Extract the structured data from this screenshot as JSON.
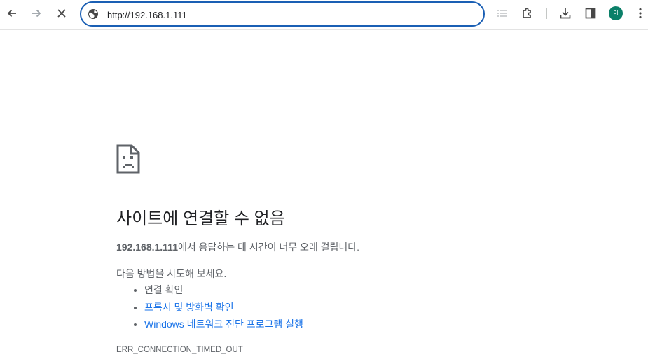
{
  "toolbar": {
    "back_icon": "arrow-left-icon",
    "forward_icon": "arrow-right-icon",
    "stop_icon": "close-icon",
    "omnibox": {
      "site_icon": "globe-icon",
      "url": "http://192.168.1.111"
    },
    "reading_list_icon": "list-icon",
    "extensions_icon": "puzzle-icon",
    "download_icon": "download-icon",
    "side_panel_icon": "side-panel-icon",
    "avatar_text": "이",
    "avatar_color": "#0b8069",
    "menu_icon": "more-vert-icon"
  },
  "error_page": {
    "icon": "sad-document-icon",
    "title": "사이트에 연결할 수 없음",
    "host": "192.168.1.111",
    "description_suffix": "에서 응답하는 데 시간이 너무 오래 걸립니다.",
    "try_heading": "다음 방법을 시도해 보세요.",
    "suggestions": [
      {
        "label": "연결 확인",
        "link": false
      },
      {
        "label": "프록시 및 방화벽 확인",
        "link": true
      },
      {
        "label": "Windows 네트워크 진단 프로그램 실행",
        "link": true
      }
    ],
    "error_code": "ERR_CONNECTION_TIMED_OUT"
  },
  "colors": {
    "accent": "#1a5fb4",
    "link": "#1a73e8",
    "text_muted": "#5f6368"
  }
}
